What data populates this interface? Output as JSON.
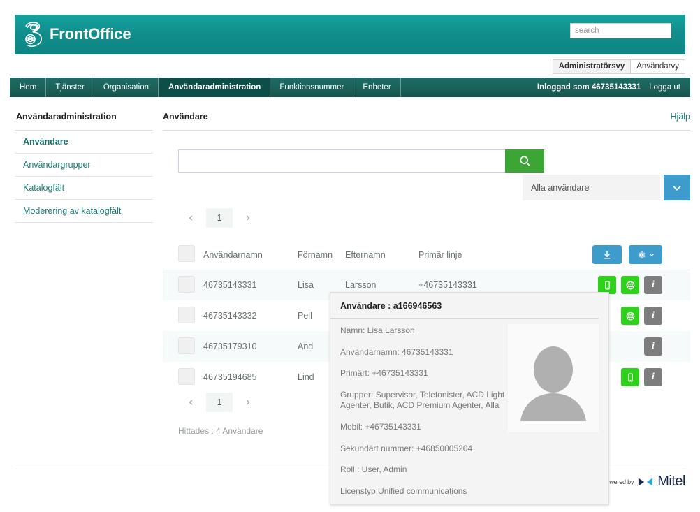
{
  "header": {
    "brand_name": "FrontOffice",
    "logo_icon": "three-logo-icon",
    "search_placeholder": "search",
    "search_value": ""
  },
  "view_switch": {
    "items": [
      {
        "label": "Administratörsvy",
        "active": true
      },
      {
        "label": "Användarvy",
        "active": false
      }
    ]
  },
  "nav": {
    "items": [
      {
        "label": "Hem",
        "active": false
      },
      {
        "label": "Tjänster",
        "active": false
      },
      {
        "label": "Organisation",
        "active": false
      },
      {
        "label": "Användaradministration",
        "active": true
      },
      {
        "label": "Funktionsnummer",
        "active": false
      },
      {
        "label": "Enheter",
        "active": false
      }
    ],
    "logged_in_label": "Inloggad som 46735143331",
    "logout_label": "Logga ut"
  },
  "sidebar": {
    "title": "Användaradministration",
    "items": [
      {
        "label": "Användare",
        "active": true
      },
      {
        "label": "Användargrupper",
        "active": false
      },
      {
        "label": "Katalogfält",
        "active": false
      },
      {
        "label": "Moderering av katalogfält",
        "active": false
      }
    ]
  },
  "content": {
    "title": "Användare",
    "help_label": "Hjälp",
    "search": {
      "value": "",
      "placeholder": "",
      "button_icon": "search-icon"
    },
    "filter": {
      "selected": "Alla användare",
      "caret_icon": "chevron-down-icon"
    },
    "pagination": {
      "prev_icon": "chevron-left-icon",
      "next_icon": "chevron-right-icon",
      "current_page": "1"
    },
    "toolbar": {
      "download_icon": "download-icon",
      "settings_icon": "gear-icon",
      "settings_caret_icon": "chevron-down-icon"
    },
    "table": {
      "columns": [
        "Användarnamn",
        "Förnamn",
        "Efternamn",
        "Primär linje"
      ],
      "rows": [
        {
          "username": "46735143331",
          "first_name": "Lisa",
          "last_name": "Larsson",
          "primary_line": "+46735143331",
          "actions": [
            "mobile-icon",
            "globe-icon",
            "info-icon"
          ]
        },
        {
          "username": "46735143332",
          "first_name": "Pell",
          "last_name": "",
          "primary_line": "",
          "actions": [
            "globe-icon",
            "info-icon"
          ]
        },
        {
          "username": "46735179310",
          "first_name": "And",
          "last_name": "",
          "primary_line": "",
          "actions": [
            "info-icon"
          ]
        },
        {
          "username": "46735194685",
          "first_name": "Lind",
          "last_name": "",
          "primary_line": "",
          "actions": [
            "mobile-icon",
            "info-icon"
          ]
        }
      ]
    },
    "found_text": "Hittades : 4 Användare"
  },
  "popover": {
    "title": "Användare : a166946563",
    "avatar_icon": "person-avatar-icon",
    "lines": [
      "Namn: Lisa Larsson",
      "Användarnamn: 46735143331",
      "Primärt: +46735143331",
      "Grupper: Supervisor, Telefonister, ACD Light Agenter, Butik, ACD Premium Agenter, Alla",
      "Mobil: +46735143331",
      "Sekundärt nummer: +46850005204",
      "Roll : User, Admin",
      "Licenstyp:Unified communications"
    ]
  },
  "footer": {
    "powered_by": "Powered by",
    "brand": "Mitel",
    "mark_icon": "mitel-bowtie-icon"
  },
  "colors": {
    "brand_teal": "#11918f",
    "nav_teal": "#1a615a",
    "nav_active": "#0e4e48",
    "accent_green": "#3ca635",
    "icon_green": "#2fd11c",
    "accent_blue": "#3e9ccc",
    "link_teal": "#1b7e7a",
    "grey_icon": "#7d7d7d"
  }
}
